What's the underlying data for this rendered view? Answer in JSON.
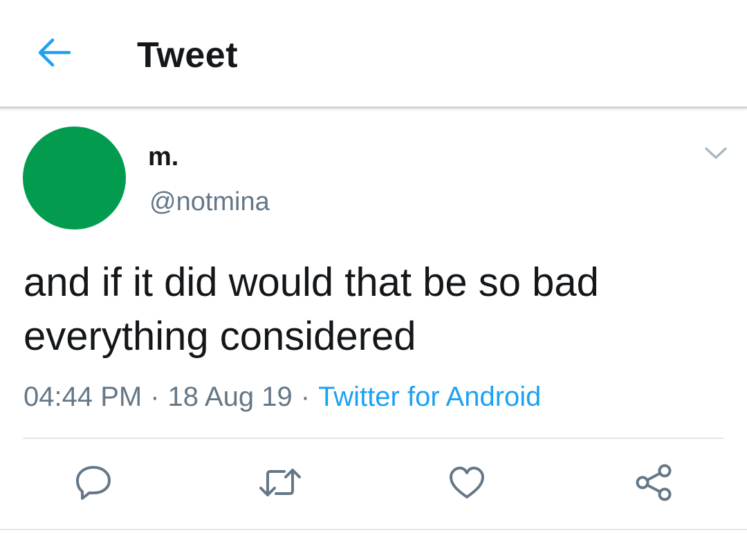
{
  "header": {
    "title": "Tweet",
    "back_icon": "arrow-left-icon"
  },
  "tweet": {
    "author": {
      "display_name": "m.",
      "handle": "@notmina",
      "avatar_color": "#039c4f"
    },
    "text": "and if it did would that be so bad everything considered",
    "time": "04:44 PM",
    "date": "18 Aug 19",
    "separator": "·",
    "source": "Twitter for Android",
    "more_icon": "chevron-down-icon"
  },
  "actions": [
    {
      "name": "reply",
      "icon": "reply-icon"
    },
    {
      "name": "retweet",
      "icon": "retweet-icon"
    },
    {
      "name": "like",
      "icon": "heart-icon"
    },
    {
      "name": "share",
      "icon": "share-icon"
    }
  ],
  "colors": {
    "accent": "#1da1f2",
    "text_primary": "#14171a",
    "text_secondary": "#657786",
    "icon_gray": "#657786",
    "divider": "#e1e8ed"
  }
}
